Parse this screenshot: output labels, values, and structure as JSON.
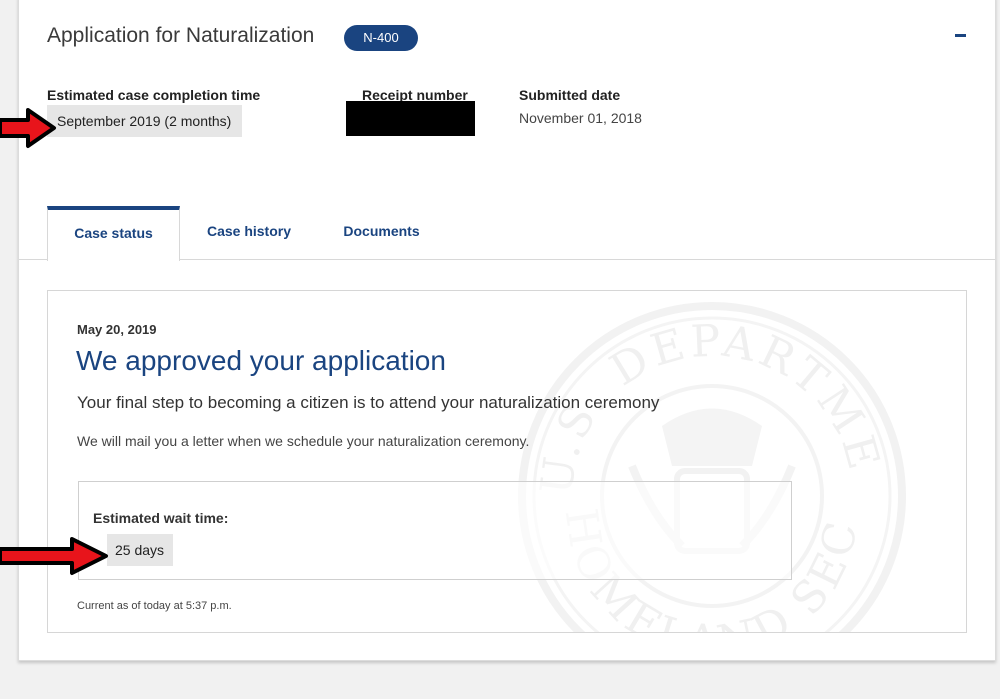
{
  "application": {
    "title": "Application for Naturalization",
    "form_badge": "N-400",
    "collapse_icon": "minus-icon"
  },
  "meta": {
    "estimated_completion_label": "Estimated case completion time",
    "estimated_completion_value": "September 2019 (2 months)",
    "receipt_label": "Receipt number",
    "receipt_value": "",
    "submitted_label": "Submitted date",
    "submitted_value": "November 01, 2018"
  },
  "tabs": [
    {
      "label": "Case status",
      "active": true
    },
    {
      "label": "Case history",
      "active": false
    },
    {
      "label": "Documents",
      "active": false
    }
  ],
  "status": {
    "date": "May 20, 2019",
    "headline": "We approved your application",
    "subheadline": "Your final step to becoming a citizen is to attend your naturalization ceremony",
    "note": "We will mail you a letter when we schedule your naturalization ceremony.",
    "wait_label": "Estimated wait time:",
    "wait_value": "25 days",
    "current_as_of": "Current as of today at 5:37 p.m."
  },
  "watermark": {
    "icon": "dhs-seal-watermark-icon",
    "text": "U.S. DEPARTMENT OF HOMELAND SECURITY"
  },
  "colors": {
    "accent": "#1a4480",
    "annotation_arrow": "#e8141b"
  }
}
